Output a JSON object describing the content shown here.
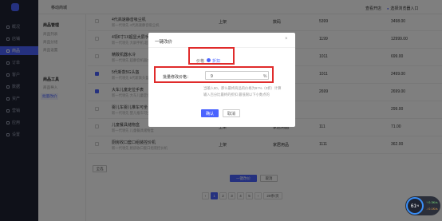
{
  "app": {
    "header_title": "移动商城",
    "header_link1": "查看开店",
    "header_link2": "选择浏览器入口"
  },
  "nav": {
    "items": [
      {
        "label": "概况",
        "active": false
      },
      {
        "label": "店铺",
        "active": false
      },
      {
        "label": "商品",
        "active": true
      },
      {
        "label": "订单",
        "active": false
      },
      {
        "label": "客户",
        "active": false
      },
      {
        "label": "数据",
        "active": false
      },
      {
        "label": "资产",
        "active": false
      },
      {
        "label": "营销",
        "active": false
      },
      {
        "label": "应用",
        "active": false
      },
      {
        "label": "设置",
        "active": false
      }
    ]
  },
  "submenu": {
    "group1": "商品管理",
    "group1_items": [
      "商品列表",
      "商品分组",
      "商品设置"
    ],
    "group2": "商品工具",
    "group2_items": [
      "商品导入",
      "批量改价"
    ]
  },
  "table": {
    "rows": [
      {
        "checked": false,
        "name": "4代高速静音吸尘机",
        "sub": "新一代领先 4代高速静音吸尘机",
        "status": "上架",
        "category": "数码",
        "stock": "5399",
        "price": "3498.00"
      },
      {
        "checked": false,
        "name": "4领6寸1X超显大屏手机",
        "sub": "新一代领先 大屏手机 超清显示",
        "status": "上架",
        "category": "手机",
        "stock": "1199",
        "price": "12999.00"
      },
      {
        "checked": false,
        "name": "精致机器水冷",
        "sub": "新一代领先 超静音机器水冷",
        "status": "",
        "category": "",
        "stock": "1011",
        "price": "699.00"
      },
      {
        "checked": true,
        "name": "5代新款5G头盔",
        "sub": "新一代领先 5代新款头盔",
        "status": "",
        "category": "",
        "stock": "1011",
        "price": "2499.00"
      },
      {
        "checked": true,
        "name": "大车儿童定位手表",
        "sub": "新一代领先 大车儿童定位手表",
        "status": "",
        "category": "",
        "stock": "2699",
        "price": "2699.00"
      },
      {
        "checked": false,
        "name": "婴儿车婴儿推车可坐",
        "sub": "新一代领先 婴儿推车可坐可躺",
        "status": "上架",
        "category": "",
        "stock": "",
        "price": "299.00"
      },
      {
        "checked": false,
        "name": "儿童餐具储物盒",
        "sub": "新一代领先 儿童餐具储物盒",
        "status": "上架",
        "category": "家居用品",
        "stock": "111",
        "price": "71.00"
      },
      {
        "checked": false,
        "name": "厨房收口套口组装控价机",
        "sub": "新一代领先 厨房收口套口组装控价机",
        "status": "上架",
        "category": "家居用品",
        "stock": "1111",
        "price": "362.00"
      }
    ],
    "select_all": "全选",
    "batch_price": "一键改价",
    "cancel": "取消"
  },
  "pager": {
    "prev": "‹",
    "pages": [
      "1",
      "2",
      "3",
      "4",
      "5"
    ],
    "next": "›",
    "size": "20条/页"
  },
  "modal": {
    "title": "一键改价",
    "close": "×",
    "price_label": "价格",
    "price_option": "折扣",
    "discount_label": "批量修改价格：",
    "discount_value": "9",
    "discount_unit": "%",
    "hint1": "当输入90，那么最终商品的价格为97%（0折）计算",
    "hint2": "输入百分比最终的折扣 最低限以下小数点的",
    "confirm": "确认",
    "cancel": "取消"
  },
  "widget": {
    "percent": "61",
    "speed_up": "0.3K/s",
    "speed_down": "0.1K/s"
  }
}
